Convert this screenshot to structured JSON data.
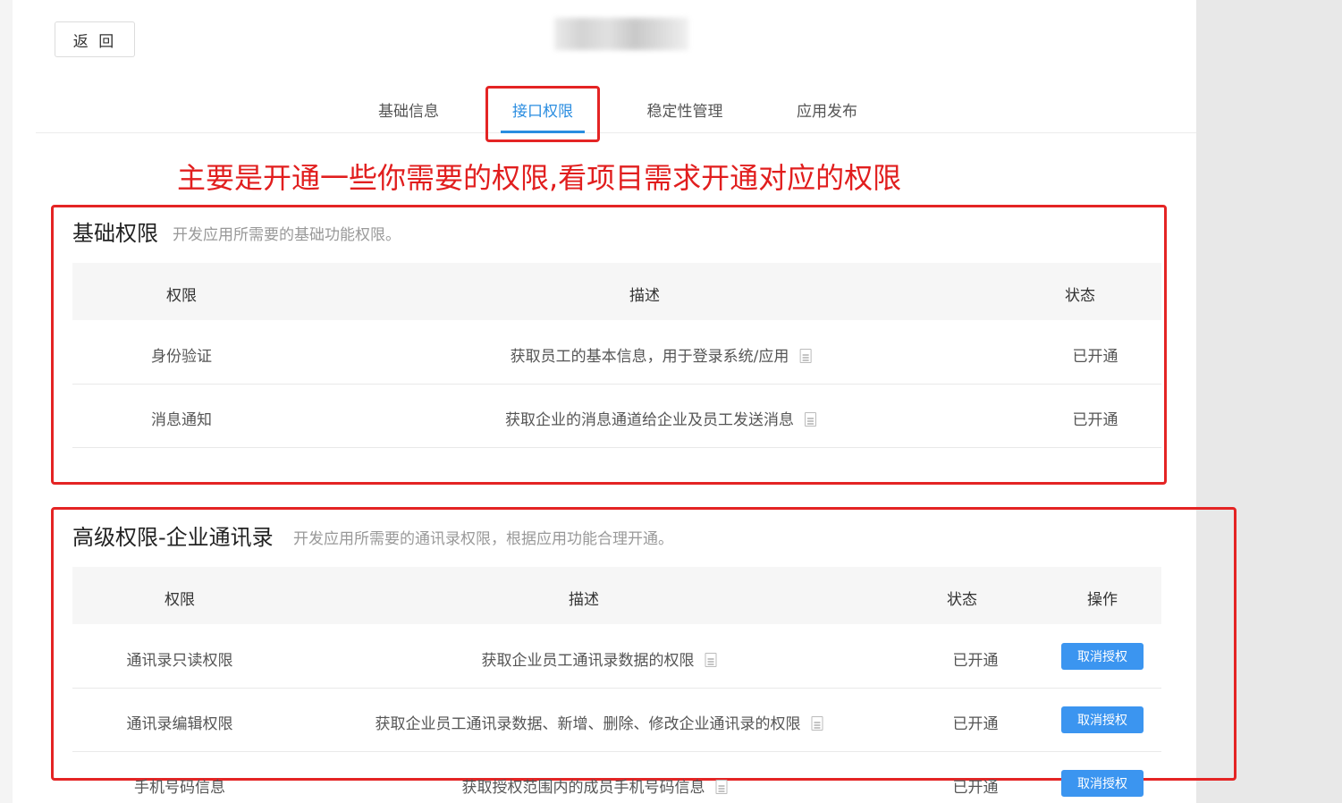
{
  "header": {
    "back_label": "返 回"
  },
  "tabs": [
    {
      "label": "基础信息",
      "active": false
    },
    {
      "label": "接口权限",
      "active": true
    },
    {
      "label": "稳定性管理",
      "active": false
    },
    {
      "label": "应用发布",
      "active": false
    }
  ],
  "annotation": "主要是开通一些你需要的权限,看项目需求开通对应的权限",
  "basic": {
    "title": "基础权限",
    "description": "开发应用所需要的基础功能权限。",
    "columns": {
      "permission": "权限",
      "description": "描述",
      "status": "状态"
    },
    "rows": [
      {
        "permission": "身份验证",
        "description": "获取员工的基本信息，用于登录系统/应用",
        "status": "已开通"
      },
      {
        "permission": "消息通知",
        "description": "获取企业的消息通道给企业及员工发送消息",
        "status": "已开通"
      }
    ]
  },
  "advanced": {
    "title": "高级权限-企业通讯录",
    "description": "开发应用所需要的通讯录权限，根据应用功能合理开通。",
    "columns": {
      "permission": "权限",
      "description": "描述",
      "status": "状态",
      "action": "操作"
    },
    "rows": [
      {
        "permission": "通讯录只读权限",
        "description": "获取企业员工通讯录数据的权限",
        "status": "已开通",
        "action": "取消授权"
      },
      {
        "permission": "通讯录编辑权限",
        "description": "获取企业员工通讯录数据、新增、删除、修改企业通讯录的权限",
        "status": "已开通",
        "action": "取消授权"
      },
      {
        "permission": "手机号码信息",
        "description": "获取授权范围内的成员手机号码信息",
        "status": "已开通",
        "action": "取消授权"
      }
    ]
  },
  "colors": {
    "accent": "#2a8de0",
    "annotation_red": "#e42424",
    "button_blue": "#3b95f0"
  }
}
